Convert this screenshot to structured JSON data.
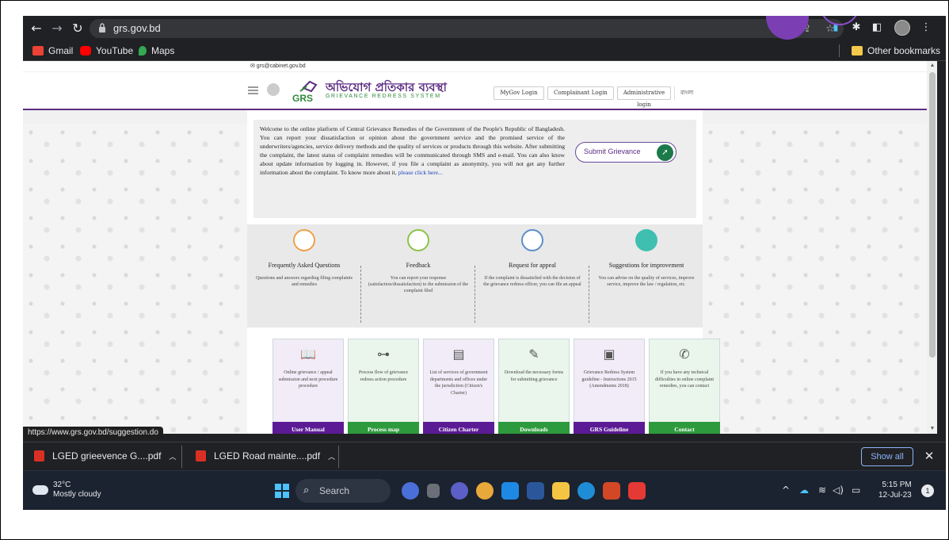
{
  "browser": {
    "url": "grs.gov.bd",
    "bookmarks": [
      {
        "label": "Gmail",
        "icon": "gmail-icon",
        "color": "#ea4335"
      },
      {
        "label": "YouTube",
        "icon": "youtube-icon",
        "color": "#ff0000"
      },
      {
        "label": "Maps",
        "icon": "maps-icon",
        "color": "#34a853"
      }
    ],
    "other_bookmarks": "Other bookmarks"
  },
  "page": {
    "email": "✉ grs@cabinet.gov.bd",
    "logo_title": "অভিযোগ প্রতিকার ব্যবস্থা",
    "logo_abbr": "GRS",
    "logo_sub": "GRIEVANCE REDRESS SYSTEM",
    "header_buttons": [
      "MyGov Login",
      "Complainant Login",
      "Administrative login"
    ],
    "language": "বাংলা",
    "welcome_text": "Welcome to the online platform of Central Grievance Remedies of the Government of the People's Republic of Bangladesh. You can report your dissatisfaction or opinion about the government service and the promised service of the underwriters/agencies, service delivery methods and the quality of services or products through this website. After submitting the complaint, the latest status of complaint remedies will be communicated through SMS and e-mail. You can also know about update information by logging in. However, if you file a complaint as anonymity, you will not get any further information about the complaint. To know more about it, ",
    "welcome_link": "please click here...",
    "submit_button": "Submit Grievance",
    "features": [
      {
        "title": "Frequently Asked Questions",
        "desc": "Questions and answers regarding filing complaints and remedies",
        "color": "#f0a04b"
      },
      {
        "title": "Feedback",
        "desc": "You can report your response (satisfaction/dissatisfaction) to the submission of the complaint filed",
        "color": "#8bc34a"
      },
      {
        "title": "Request for appeal",
        "desc": "If the complaint is dissatisfied with the decision of the grievance redress officer, you can file an appeal",
        "color": "#5b8fc9"
      },
      {
        "title": "Suggestions for improvement",
        "desc": "You can advise on the quality of services, improve service, improve the law / regulation, etc.",
        "color": "#3fbfb0"
      }
    ],
    "cards": [
      {
        "text": "Online grievance / appeal submission and next procedure procedure",
        "button": "User Manual",
        "bg": "#f1ecf7",
        "btn": "#5b1b95",
        "icon": "book-icon",
        "glyph": "📖"
      },
      {
        "text": "Process flow of grievance redress action procedure",
        "button": "Process map",
        "bg": "#eaf6ec",
        "btn": "#2e9a3e",
        "icon": "sitemap-icon",
        "glyph": "⊶"
      },
      {
        "text": "List of services of government departments and offices under the jurisdiction (Citizen's Charter)",
        "button": "Citizen Charter",
        "bg": "#f1ecf7",
        "btn": "#5b1b95",
        "icon": "document-list-icon",
        "glyph": "▤"
      },
      {
        "text": "Download the necessary forms for submitting grievance",
        "button": "Downloads",
        "bg": "#eaf6ec",
        "btn": "#2e9a3e",
        "icon": "edit-form-icon",
        "glyph": "✎"
      },
      {
        "text": "Grievance Redress System guideline - Instructions 2015 (Amendments 2018)",
        "button": "GRS Guideline",
        "bg": "#f1ecf7",
        "btn": "#5b1b95",
        "icon": "guideline-icon",
        "glyph": "▣"
      },
      {
        "text": "If you have any technical difficulties in online complaint remedies, you can contact",
        "button": "Contact",
        "bg": "#eaf6ec",
        "btn": "#2e9a3e",
        "icon": "phone-icon",
        "glyph": "✆"
      }
    ]
  },
  "status_url": "https://www.grs.gov.bd/suggestion.do",
  "downloads": {
    "items": [
      "LGED grieevence G....pdf",
      "LGED Road mainte....pdf"
    ],
    "show_all": "Show all"
  },
  "taskbar": {
    "temperature": "32°C",
    "weather": "Mostly cloudy",
    "search_label": "Search",
    "time": "5:15 PM",
    "date": "12-Jul-23",
    "notifications": "1"
  }
}
